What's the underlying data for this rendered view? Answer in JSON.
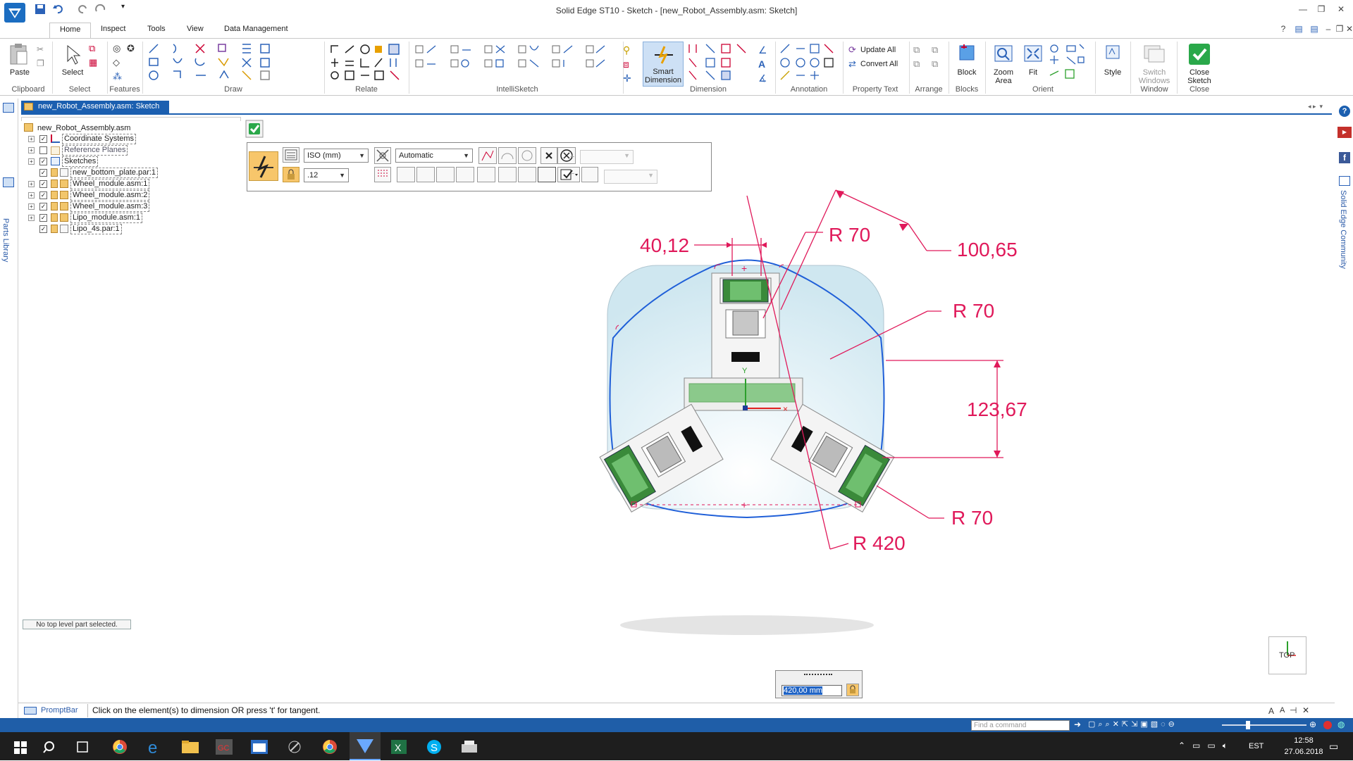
{
  "window": {
    "title": "Solid Edge ST10 - Sketch - [new_Robot_Assembly.asm: Sketch]"
  },
  "ribbon": {
    "tabs": [
      "Home",
      "Inspect",
      "Tools",
      "View",
      "Data Management"
    ],
    "groups": {
      "clipboard": "Clipboard",
      "select": "Select",
      "features": "Features",
      "draw": "Draw",
      "relate": "Relate",
      "intellisketch": "IntelliSketch",
      "dimension": "Dimension",
      "annotation": "Annotation",
      "property_text": "Property Text",
      "arrange": "Arrange",
      "blocks": "Blocks",
      "orient": "Orient",
      "window": "Window",
      "close": "Close"
    },
    "buttons": {
      "paste": "Paste",
      "select": "Select",
      "smart_dimension_1": "Smart",
      "smart_dimension_2": "Dimension",
      "update_all": "Update All",
      "convert_all": "Convert All",
      "block": "Block",
      "zoom_area_1": "Zoom",
      "zoom_area_2": "Area",
      "fit": "Fit",
      "style": "Style",
      "switch_windows_1": "Switch",
      "switch_windows_2": "Windows",
      "close_sketch_1": "Close",
      "close_sketch_2": "Sketch"
    }
  },
  "side": {
    "parts_library": "Parts Library",
    "community": "Solid Edge Community"
  },
  "document_tab": "new_Robot_Assembly.asm: Sketch",
  "tree": {
    "root": "new_Robot_Assembly.asm",
    "items": [
      "Coordinate Systems",
      "Reference Planes",
      "Sketches",
      "new_bottom_plate.par:1",
      "Wheel_module.asm:1",
      "Wheel_module.asm:2",
      "Wheel_module.asm:3",
      "Lipo_module.asm:1",
      "Lipo_4s.par:1"
    ]
  },
  "status_part": "No top level part selected.",
  "command_bar": {
    "standard": "ISO (mm)",
    "mode": "Automatic",
    "precision": ".12"
  },
  "dimensions": {
    "d1": "40,12",
    "d2": "R 70",
    "d3": "100,65",
    "d4": "R 70",
    "d5": "123,67",
    "d6": "R 70",
    "d7": "R 420"
  },
  "axis": {
    "y": "Y"
  },
  "view_cube": "TOP",
  "dim_entry": {
    "value": "420,00 mm"
  },
  "promptbar": {
    "label": "PromptBar",
    "text": "Click on the element(s) to dimension OR press 't' for tangent."
  },
  "statusbar": {
    "find_placeholder": "Find a command"
  },
  "taskbar": {
    "lang": "EST",
    "time": "12:58",
    "date": "27.06.2018"
  },
  "colors": {
    "accent": "#1b5fb0",
    "dimension": "#e0195a",
    "outline": "#1f5fd8"
  }
}
